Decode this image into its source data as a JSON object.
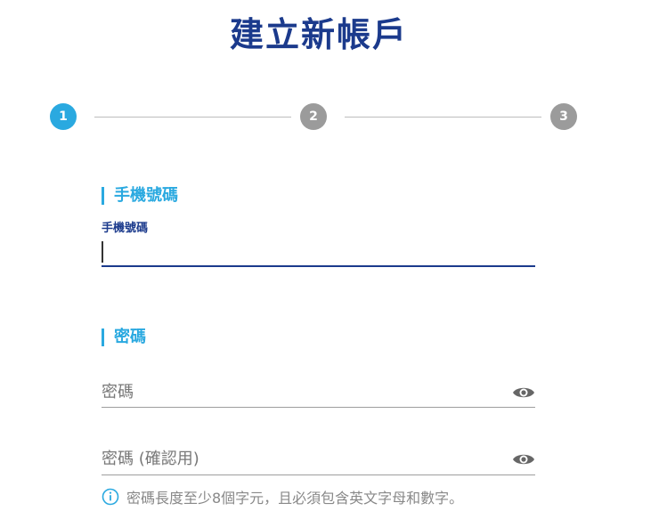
{
  "page": {
    "title": "建立新帳戶"
  },
  "stepper": {
    "steps": [
      "1",
      "2",
      "3"
    ],
    "active_index": 0
  },
  "phone_section": {
    "title": "手機號碼",
    "field_label": "手機號碼",
    "value": ""
  },
  "password_section": {
    "title": "密碼",
    "password_placeholder": "密碼",
    "confirm_placeholder": "密碼 (確認用)",
    "hint": "密碼長度至少8個字元，且必須包含英文字母和數字。"
  },
  "colors": {
    "brand_dark": "#1b3a8c",
    "accent": "#2aa9e0",
    "inactive_step": "#9b9b9b"
  },
  "icons": {
    "password_visibility": "eye-icon",
    "hint": "info-icon"
  }
}
